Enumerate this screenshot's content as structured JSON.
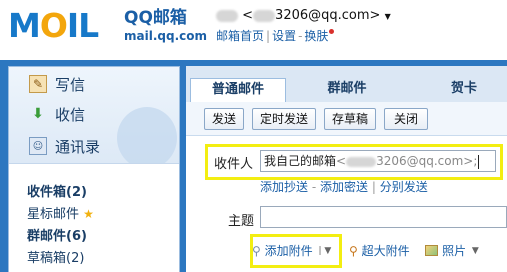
{
  "header": {
    "logo_text": "MOIL",
    "brand_name": "QQ邮箱",
    "brand_url": "mail.qq.com",
    "user_account": "3206@qq.com>",
    "user_prefix": "<",
    "links": [
      "邮箱首页",
      "设置",
      "换肤"
    ]
  },
  "sidebar": {
    "nav": [
      {
        "label": "写信",
        "icon": "write-icon"
      },
      {
        "label": "收信",
        "icon": "inbox-download-icon"
      },
      {
        "label": "通讯录",
        "icon": "contacts-icon"
      }
    ],
    "folders": [
      {
        "label": "收件箱(2)",
        "bold": true
      },
      {
        "label": "星标邮件",
        "bold": false
      },
      {
        "label": "群邮件(6)",
        "bold": true
      },
      {
        "label": "草稿箱(2)",
        "bold": false
      }
    ]
  },
  "compose": {
    "tabs": [
      "普通邮件",
      "群邮件",
      "贺卡"
    ],
    "active_tab": "普通邮件",
    "toolbar": [
      "发送",
      "定时发送",
      "存草稿",
      "关闭"
    ],
    "to_label": "收件人",
    "to_value_name": "我自己的邮箱",
    "to_value_addr_open": "<",
    "to_value_addr_rest": "3206@qq.com>;",
    "links": [
      "添加抄送",
      "添加密送",
      "分别发送"
    ],
    "subject_label": "主题",
    "subject_value": "",
    "attach": [
      "添加附件",
      "超大附件",
      "照片"
    ]
  },
  "colors": {
    "frame_blue": "#2c77c0",
    "highlight_yellow": "#f3ee11",
    "link_blue": "#1b5fa6"
  }
}
